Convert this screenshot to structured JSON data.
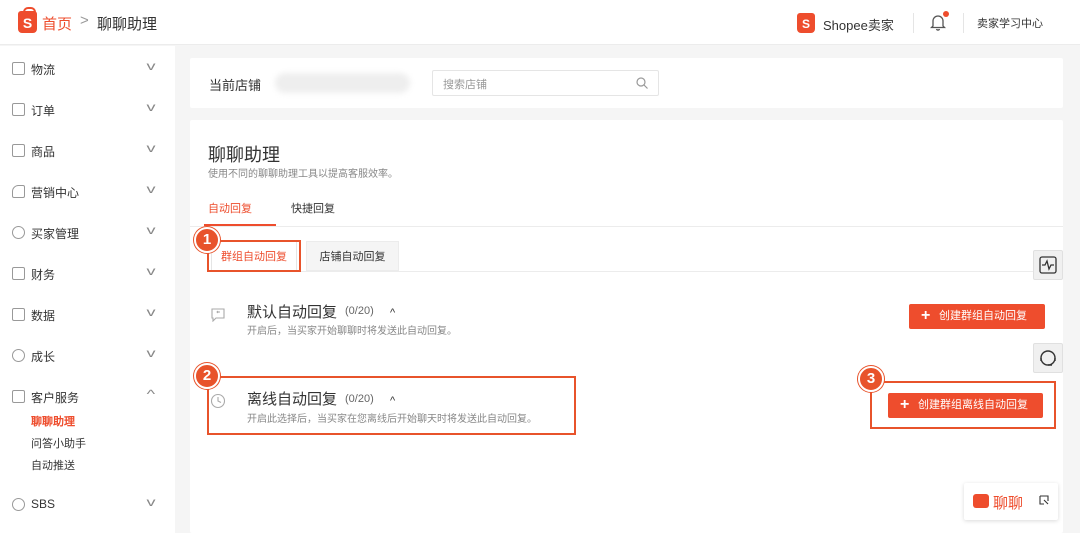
{
  "header": {
    "home_label": "首页",
    "separator": ">",
    "page_label": "聊聊助理",
    "seller_brand": "Shopee卖家",
    "learning_center": "卖家学习中心",
    "brand_color": "#ee4d2d"
  },
  "sidebar": {
    "items": [
      {
        "label": "物流",
        "icon": "truck-icon"
      },
      {
        "label": "订单",
        "icon": "clipboard-icon"
      },
      {
        "label": "商品",
        "icon": "box-icon"
      },
      {
        "label": "营销中心",
        "icon": "tag-icon"
      },
      {
        "label": "买家管理",
        "icon": "user-icon"
      },
      {
        "label": "财务",
        "icon": "wallet-icon"
      },
      {
        "label": "数据",
        "icon": "chart-icon"
      },
      {
        "label": "成长",
        "icon": "medal-icon"
      },
      {
        "label": "客户服务",
        "icon": "chat-icon"
      },
      {
        "label": "SBS",
        "icon": "sbs-icon"
      }
    ],
    "sub_items": [
      {
        "label": "聊聊助理",
        "active": true
      },
      {
        "label": "问答小助手",
        "active": false
      },
      {
        "label": "自动推送",
        "active": false
      }
    ]
  },
  "store_bar": {
    "label": "当前店铺",
    "search_placeholder": "搜索店铺"
  },
  "main": {
    "title": "聊聊助理",
    "subtitle": "使用不同的聊聊助理工具以提高客服效率。",
    "tabs": [
      {
        "label": "自动回复",
        "active": true
      },
      {
        "label": "快捷回复",
        "active": false
      }
    ],
    "subtabs": [
      {
        "label": "群组自动回复",
        "active": true
      },
      {
        "label": "店铺自动回复",
        "active": false
      }
    ],
    "sections": [
      {
        "title": "默认自动回复",
        "count": "(0/20)",
        "caret": "^",
        "desc": "开启后，当买家开始聊聊时将发送此自动回复。",
        "button": "创建群组自动回复"
      },
      {
        "title": "离线自动回复",
        "count": "(0/20)",
        "caret": "^",
        "desc": "开启此选择后，当买家在您离线后开始聊天时将发送此自动回复。",
        "button": "创建群组离线自动回复"
      }
    ]
  },
  "annotations": [
    "1",
    "2",
    "3"
  ],
  "chat_widget": {
    "label": "聊聊"
  }
}
